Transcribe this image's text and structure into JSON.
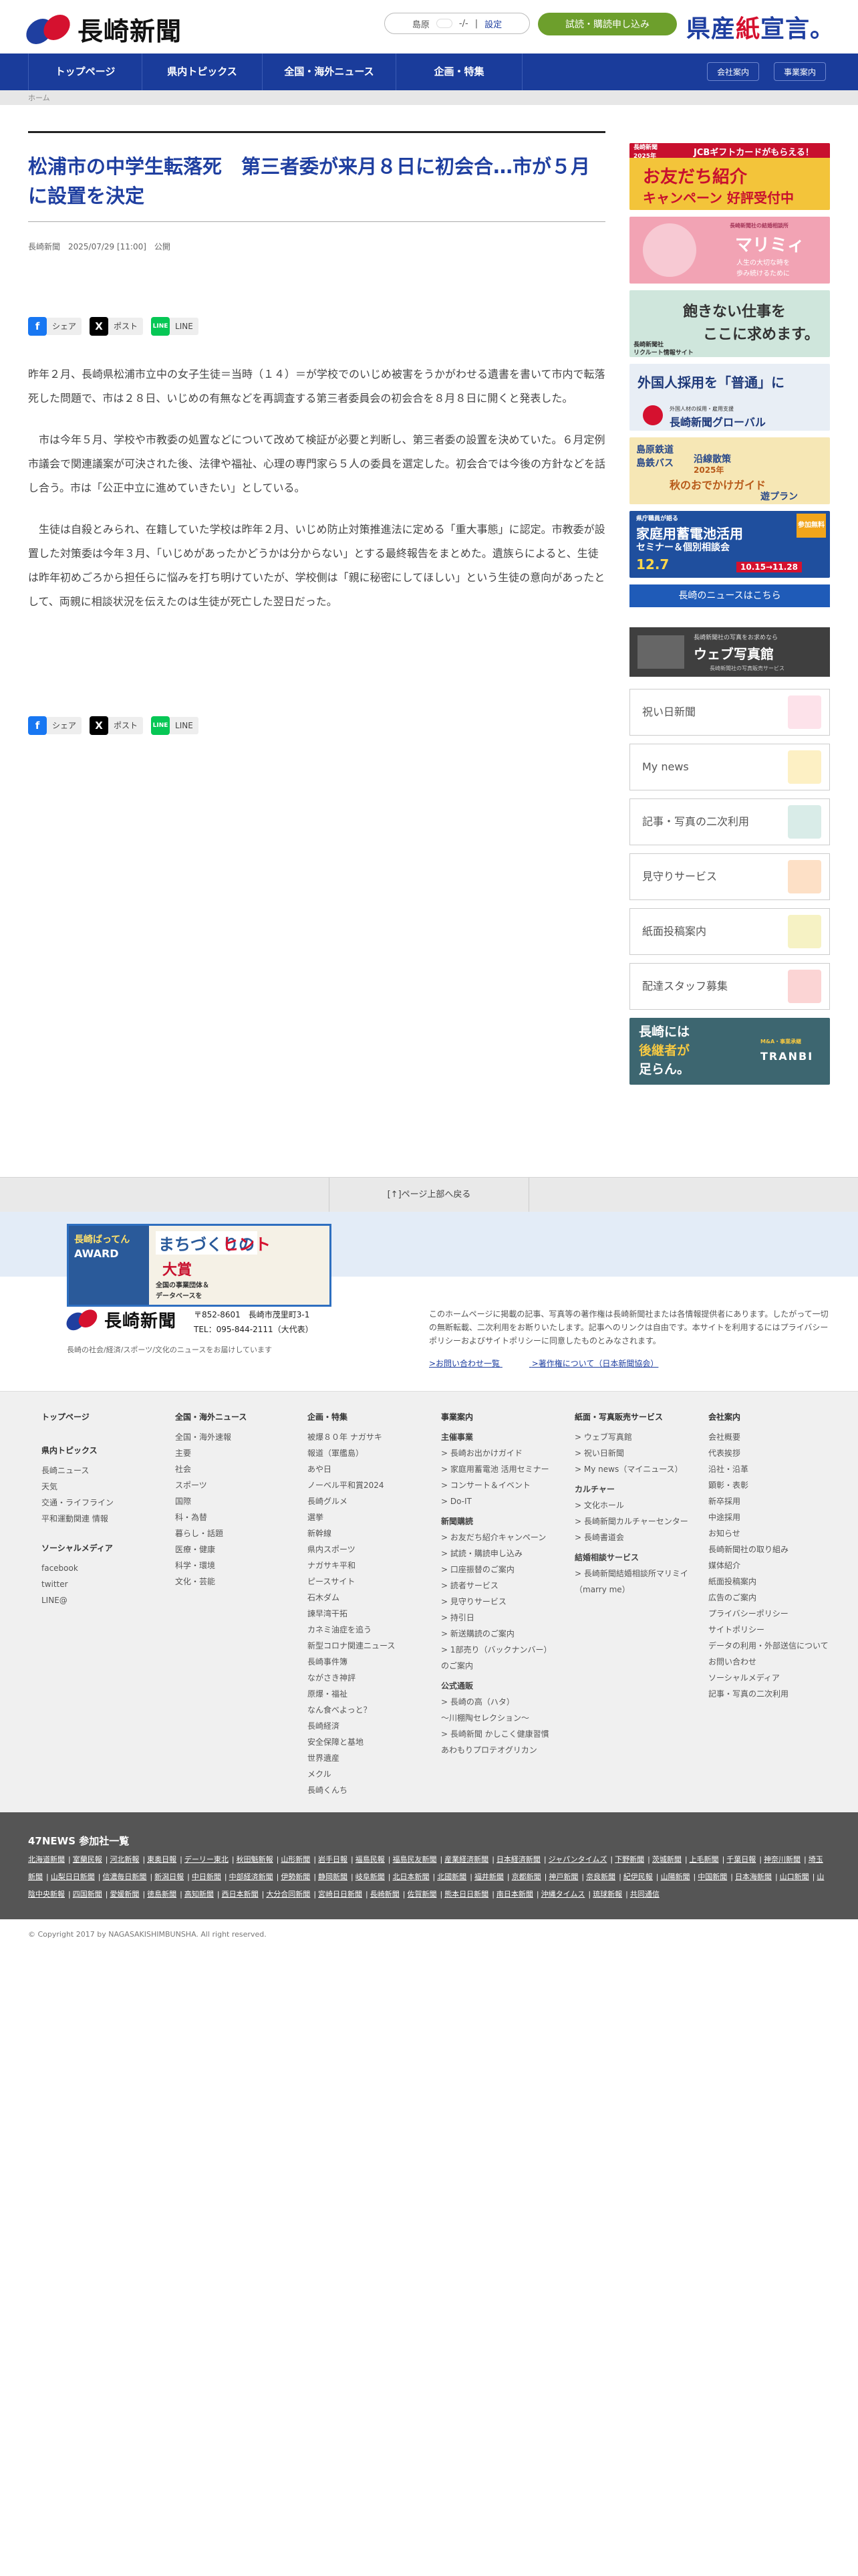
{
  "header": {
    "logo_text": "長崎新聞",
    "weather_area": "島原",
    "weather_temp": "-/-",
    "weather_setting": "設定",
    "trial_button": "試読・購読申し込み",
    "kensan_a": "県産",
    "kensan_b": "紙",
    "kensan_c": "宣言。"
  },
  "nav": {
    "items": [
      "トップページ",
      "県内トピックス",
      "全国・海外ニュース",
      "企画・特集"
    ],
    "company": "会社案内",
    "business": "事業案内"
  },
  "breadcrumb": "ホーム",
  "article": {
    "title": "松浦市の中学生転落死　第三者委が来月８日に初会合…市が５月に設置を決定",
    "meta": "長崎新聞　2025/07/29 [11:00]　公開",
    "share": {
      "facebook": "シェア",
      "x": "ポスト",
      "line": "LINE"
    },
    "paragraphs": [
      "昨年２月、長崎県松浦市立中の女子生徒＝当時（１４）＝が学校でのいじめ被害をうかがわせる遺書を書いて市内で転落死した問題で、市は２８日、いじめの有無などを再調査する第三者委員会の初会合を８月８日に開くと発表した。",
      "　市は今年５月、学校や市教委の処置などについて改めて検証が必要と判断し、第三者委の設置を決めていた。６月定例市議会で関連議案が可決された後、法律や福祉、心理の専門家ら５人の委員を選定した。初会合では今後の方針などを話し合う。市は「公正中立に進めていきたい」としている。",
      "　生徒は自殺とみられ、在籍していた学校は昨年２月、いじめ防止対策推進法に定める「重大事態」に認定。市教委が設置した対策委は今年３月、「いじめがあったかどうかは分からない」とする最終報告をまとめた。遺族らによると、生徒は昨年初めごろから担任らに悩みを打ち明けていたが、学校側は「親に秘密にしてほしい」という生徒の意向があったとして、両親に相談状況を伝えたのは生徒が死亡した翌日だった。"
    ]
  },
  "sidebar": {
    "ads": [
      {
        "lines": [
          "JCBギフトカードがもらえる！",
          "お友だち紹介",
          "キャンペーン 好評受付中",
          "長崎新聞",
          "2025年"
        ],
        "bg": "#f3c43a"
      },
      {
        "lines": [
          "マリミィ",
          "人生の大切な時を",
          "歩み続けるために",
          "長崎新聞社の結婚相談所"
        ],
        "bg": "#f2a3b4"
      },
      {
        "lines": [
          "飽きない仕事を",
          "ここに求めます。",
          "長崎新聞社",
          "リクルート情報サイト"
        ],
        "bg": "#cfe6dc"
      },
      {
        "lines": [
          "外国人採用を「普通」に",
          "外国人材の採用・雇用支援",
          "長崎新聞グローバル"
        ],
        "bg": "#e8eef5"
      },
      {
        "lines": [
          "島原鉄道",
          "島鉄バス",
          "沿線散策",
          "2025年",
          "秋のおでかけガイド",
          "遊プラン"
        ],
        "bg": "#f6e7b5"
      },
      {
        "lines": [
          "県庁職員が語る",
          "家庭用蓄電池活用",
          "セミナー＆個別相談会",
          "参加無料",
          "12.7",
          "10.15→11.28"
        ],
        "bg": "#1f4f9e"
      }
    ],
    "news_button": "長崎のニュースはこちら",
    "photo_banner": [
      "長崎新聞社の写真をお求めなら",
      "ウェブ写真館",
      "長崎新聞社の写真販売サービス"
    ],
    "boxes": [
      "祝い日新聞",
      "My news",
      "記事・写真の二次利用",
      "見守りサービス",
      "紙面投稿案内",
      "配達スタッフ募集"
    ],
    "tranbi": [
      "長崎には",
      "後継者が",
      "足らん。",
      "TRANBI",
      "M&A・事業承継"
    ]
  },
  "pagetop": "[↑]ページ上部へ戻る",
  "footer_banner": [
    "長崎ばってん",
    "AWARD",
    "まちづくりの",
    "ヒント",
    "大賞",
    "全国の事業団体＆",
    "データベースを"
  ],
  "footer": {
    "logo_text": "長崎新聞",
    "postal": "〒852-8601　長崎市茂里町3-1",
    "tel": "TEL：095-844-2111（大代表）",
    "desc": "長崎の社会/経済/スポーツ/文化のニュースをお届けしています",
    "copy_note": "このホームページに掲載の記事、写真等の著作権は長崎新聞社または各情報提供者にあります。したがって一切の無断転載、二次利用をお断りいたします。記事へのリンクは自由です。本サイトを利用するにはプライバシーポリシーおよびサイトポリシーに同意したものとみなされます。",
    "contact": ">お問い合わせ一覧",
    "copyright_link": ">著作権について（日本新聞協会）"
  },
  "sitemap": {
    "c1": {
      "h": "トップページ",
      "h2": "県内トピックス",
      "items": [
        "長崎ニュース",
        "天気",
        "交通・ライフライン",
        "平和運動関連 情報"
      ],
      "h3": "ソーシャルメディア",
      "social": [
        "facebook",
        "twitter",
        "LINE@"
      ]
    },
    "c2": {
      "h": "全国・海外ニュース",
      "items": [
        "全国・海外速報",
        "主要",
        "社会",
        "スポーツ",
        "国際",
        "科・為替",
        "暮らし・話題",
        "医療・健康",
        "科学・環境",
        "文化・芸能"
      ]
    },
    "c3": {
      "h": "企画・特集",
      "items": [
        "被爆８０年 ナガサキ",
        "報道（軍艦島）",
        "あや日",
        "ノーベル平和賞2024",
        "長崎グルメ",
        "選挙",
        "新幹線",
        "県内スポーツ",
        "ナガサキ平和",
        "ピースサイト",
        "石木ダム",
        "諫早湾干拓",
        "カネミ油症を追う",
        "新型コロナ関連ニュース",
        "長崎事件簿",
        "ながさき神評",
        "原爆・福祉",
        "なん食べよっと？",
        "長崎経済",
        "安全保障と基地",
        "世界遺産",
        "メクル",
        "長崎くんち"
      ]
    },
    "c4": {
      "h": "事業案内",
      "g1": "主催事業",
      "g1i": [
        "> 長崎お出かけガイド",
        "> 家庭用蓄電池 活用セミナー",
        "> コンサート＆イベント",
        "> Do-IT"
      ],
      "g2": "新聞購読",
      "g2i": [
        "> お友だち紹介キャンペーン",
        "> 試読・購読申し込み",
        "> 口座振替のご案内",
        "> 読者サービス",
        "> 見守りサービス",
        "> 持引日",
        "> 新送購読のご案内",
        "> 1部売り（バックナンバー）のご案内"
      ],
      "g3": "公式通販",
      "g3i": [
        "> 長崎の高（ハタ）",
        "～川棚陶セレクション～",
        "> 長崎新聞 かしこく健康習慣",
        "あわもりプロテオグリカン"
      ]
    },
    "c5": {
      "h": "紙面・写真販売サービス",
      "items": [
        "> ウェブ写真館",
        "> 祝い日新聞",
        "> My news（マイニュース）"
      ],
      "g2": "カルチャー",
      "g2i": [
        "> 文化ホール",
        "> 長崎新聞カルチャーセンター",
        "> 長崎書道会"
      ],
      "g3": "結婚相談サービス",
      "g3i": [
        "> 長崎新聞結婚相談所マリミイ（marry me）"
      ]
    },
    "c6": {
      "h": "会社案内",
      "items": [
        "会社概要",
        "代表挨拶",
        "沿社・沿革",
        "顕彰・表彰",
        "新卒採用",
        "中途採用",
        "お知らせ",
        "長崎新聞社の取り組み",
        "媒体紹介",
        "紙面投稿案内",
        "広告のご案内",
        "プライバシーポリシー",
        "サイトポリシー",
        "データの利用・外部送信について",
        "お問い合わせ",
        "ソーシャルメディア",
        "記事・写真の二次利用"
      ]
    }
  },
  "news47": {
    "title": "47NEWS 参加社一覧",
    "papers": [
      "北海道新聞",
      "室蘭民報",
      "河北新報",
      "東奥日報",
      "デーリー東北",
      "秋田魁新報",
      "山形新聞",
      "岩手日報",
      "福島民報",
      "福島民友新聞",
      "産業経済新聞",
      "日本経済新聞",
      "ジャパンタイムズ",
      "下野新聞",
      "茨城新聞",
      "上毛新聞",
      "千葉日報",
      "神奈川新聞",
      "埼玉新聞",
      "山梨日日新聞",
      "信濃毎日新聞",
      "新潟日報",
      "中日新聞",
      "中部経済新聞",
      "伊勢新聞",
      "静岡新聞",
      "岐阜新聞",
      "北日本新聞",
      "北國新聞",
      "福井新聞",
      "京都新聞",
      "神戸新聞",
      "奈良新聞",
      "紀伊民報",
      "山陽新聞",
      "中国新聞",
      "日本海新聞",
      "山口新聞",
      "山陰中央新報",
      "四国新聞",
      "愛媛新聞",
      "徳島新聞",
      "高知新聞",
      "西日本新聞",
      "大分合同新聞",
      "宮崎日日新聞",
      "長崎新聞",
      "佐賀新聞",
      "熊本日日新聞",
      "南日本新聞",
      "沖縄タイムス",
      "琉球新報",
      "共同通信"
    ]
  },
  "copyright": "© Copyright 2017 by NAGASAKISHIMBUNSHA. All right reserved.",
  "colors": {
    "brand_blue": "#1f3fa0",
    "brand_red": "#d5112f",
    "nav_bg": "#1a3c9b",
    "trial_green": "#6d9f2c",
    "news47_bg": "#555555"
  }
}
